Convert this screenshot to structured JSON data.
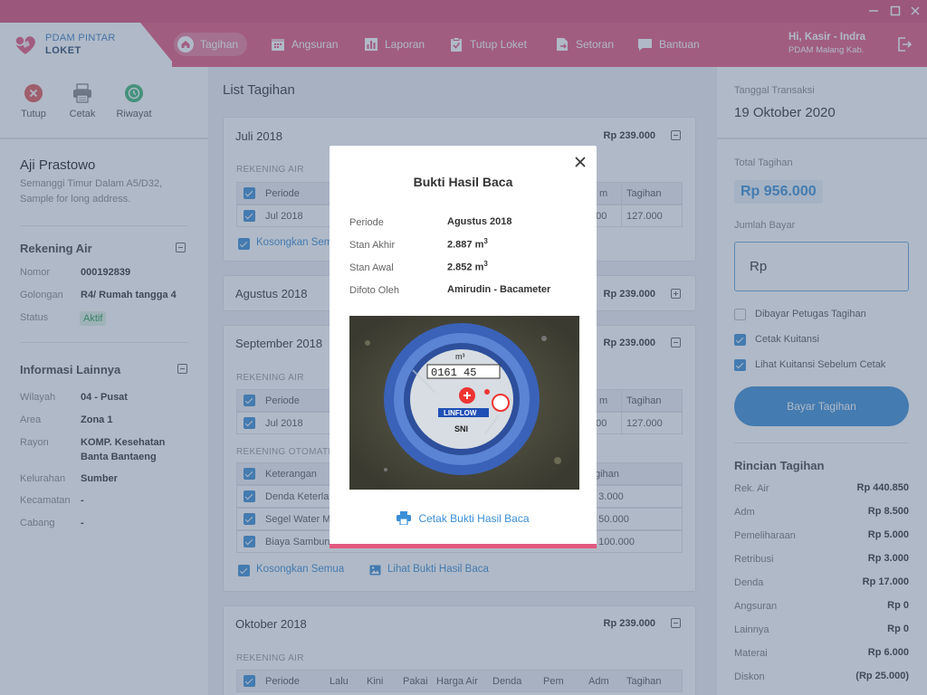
{
  "app": {
    "brand_line1": "PDAM PINTAR",
    "brand_line2": "LOKET"
  },
  "nav": [
    {
      "label": "Tagihan",
      "icon": "home-icon",
      "active": true
    },
    {
      "label": "Angsuran",
      "icon": "calendar-icon"
    },
    {
      "label": "Laporan",
      "icon": "bar-chart-icon"
    },
    {
      "label": "Tutup Loket",
      "icon": "clipboard-check-icon"
    },
    {
      "label": "Setoran",
      "icon": "document-arrow-icon"
    },
    {
      "label": "Bantuan",
      "icon": "chat-bubble-icon"
    }
  ],
  "user": {
    "greeting": "Hi, Kasir - Indra",
    "org": "PDAM Malang Kab."
  },
  "toolbar": {
    "tutup": "Tutup",
    "cetak": "Cetak",
    "riwayat": "Riwayat"
  },
  "customer": {
    "name": "Aji Prastowo",
    "address": "Semanggi Timur Dalam A5/D32, Sample for long address.",
    "rekening_title": "Rekening Air",
    "rekening": [
      {
        "k": "Nomor",
        "v": "000192839"
      },
      {
        "k": "Golongan",
        "v": "R4/ Rumah tangga 4"
      },
      {
        "k": "Status",
        "v": "Aktif"
      }
    ],
    "info_title": "Informasi Lainnya",
    "info": [
      {
        "k": "Wilayah",
        "v": "04 - Pusat"
      },
      {
        "k": "Area",
        "v": "Zona 1"
      },
      {
        "k": "Rayon",
        "v": "KOMP. Kesehatan Banta Bantaeng"
      },
      {
        "k": "Kelurahan",
        "v": "Sumber"
      },
      {
        "k": "Kecamatan",
        "v": "-"
      },
      {
        "k": "Cabang",
        "v": "-"
      }
    ]
  },
  "list": {
    "title": "List Tagihan",
    "rekening_air": "REKENING AIR",
    "rekening_otomatis": "REKENING OTOMATIS",
    "kosongkan": "Kosongkan Semua",
    "lihat_bukti": "Lihat Bukti Hasil Baca",
    "cards": [
      {
        "month": "Juli 2018",
        "amount": "Rp 239.000"
      },
      {
        "month": "Agustus 2018",
        "amount": "Rp 239.000"
      },
      {
        "month": "September 2018",
        "amount": "Rp 239.000"
      },
      {
        "month": "Oktober 2018",
        "amount": "Rp 239.000"
      }
    ],
    "hdr_periode": "Periode",
    "hdr_adm_short": "m",
    "hdr_tagihan": "Tagihan",
    "row_periode": "Jul 2018",
    "row_adm_partial": "500",
    "row_tagihan": "127.000",
    "hdr_keterangan": "Keterangan",
    "hdr_tagihan_partial": "gihan",
    "otomatis_rows": [
      {
        "label": "Denda Keterla",
        "val": "p 3.000"
      },
      {
        "label": "Segel Water M",
        "val": "p 50.000"
      },
      {
        "label": "Biaya Sambun",
        "val": "p 100.000"
      }
    ],
    "oktober_headers": [
      "Periode",
      "Lalu",
      "Kini",
      "Pakai",
      "Harga Air",
      "Denda",
      "Pem",
      "Adm",
      "Tagihan"
    ]
  },
  "right": {
    "tgl_label": "Tanggal Transaksi",
    "tgl": "19 Oktober 2020",
    "total_label": "Total Tagihan",
    "total": "Rp 956.000",
    "jumlah_label": "Jumlah Bayar",
    "jumlah_prefix": "Rp",
    "opt_petugas": "Dibayar Petugas Tagihan",
    "opt_cetak": "Cetak Kuitansi",
    "opt_lihat": "Lihat Kuitansi Sebelum Cetak",
    "btn_bayar": "Bayar Tagihan",
    "rincian_title": "Rincian Tagihan",
    "rincian": [
      {
        "k": "Rek. Air",
        "v": "Rp 440.850"
      },
      {
        "k": "Adm",
        "v": "Rp 8.500"
      },
      {
        "k": "Pemeliharaan",
        "v": "Rp 5.000"
      },
      {
        "k": "Retribusi",
        "v": "Rp 3.000"
      },
      {
        "k": "Denda",
        "v": "Rp 17.000"
      },
      {
        "k": "Angsuran",
        "v": "Rp 0"
      },
      {
        "k": "Lainnya",
        "v": "Rp 0"
      },
      {
        "k": "Materai",
        "v": "Rp 6.000"
      },
      {
        "k": "Diskon",
        "v": "(Rp 25.000)"
      }
    ]
  },
  "modal": {
    "title": "Bukti Hasil Baca",
    "periode_k": "Periode",
    "periode_v": "Agustus 2018",
    "akhir_k": "Stan Akhir",
    "akhir_v": "2.887 m",
    "awal_k": "Stan Awal",
    "awal_v": "2.852 m",
    "foto_k": "Difoto Oleh",
    "foto_v": "Amirudin - Bacameter",
    "unit_sup": "3",
    "photo_reading": "0161 45",
    "photo_brand": "LINFLOW",
    "photo_mark": "SNI",
    "print_label": "Cetak Bukti Hasil Baca"
  },
  "colors": {
    "brand": "#e3587f",
    "accent": "#3b8fd6"
  }
}
